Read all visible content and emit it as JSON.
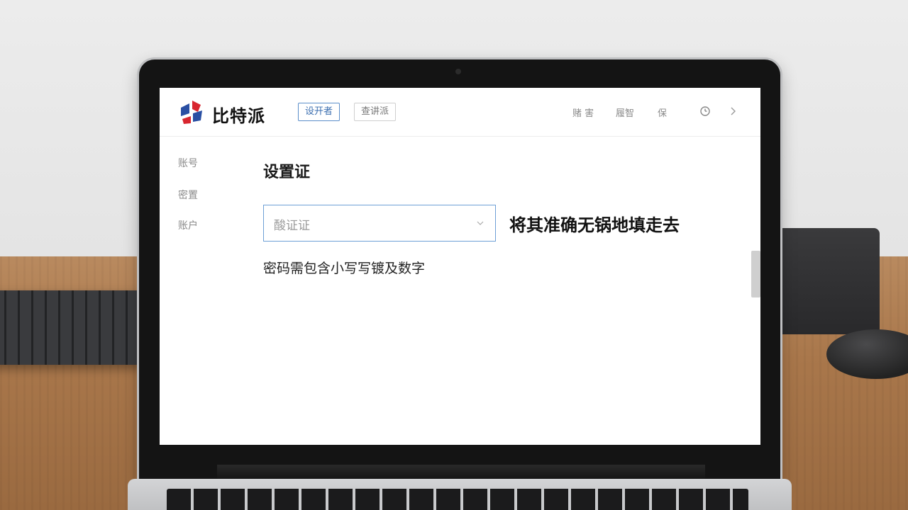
{
  "header": {
    "brand": "比特派",
    "nav_buttons": [
      "设开者",
      "查讲派"
    ],
    "links": [
      "赌 害",
      "履智",
      "保"
    ],
    "icons": [
      "clock-icon",
      "chevron-right-icon"
    ]
  },
  "sidebar": {
    "items": [
      {
        "label": "账号"
      },
      {
        "label": "密置"
      },
      {
        "label": "账户"
      }
    ]
  },
  "main": {
    "title": "设置证",
    "select": {
      "value": "酸证证"
    },
    "annotation": "将其准确无锅地填走去",
    "hint": "密码需包含小写写镀及数字"
  },
  "colors": {
    "accent_border": "#6d9fd6",
    "primary_button_text": "#3c6fb0",
    "logo_red": "#d8262f",
    "logo_blue": "#2a4fa3"
  }
}
